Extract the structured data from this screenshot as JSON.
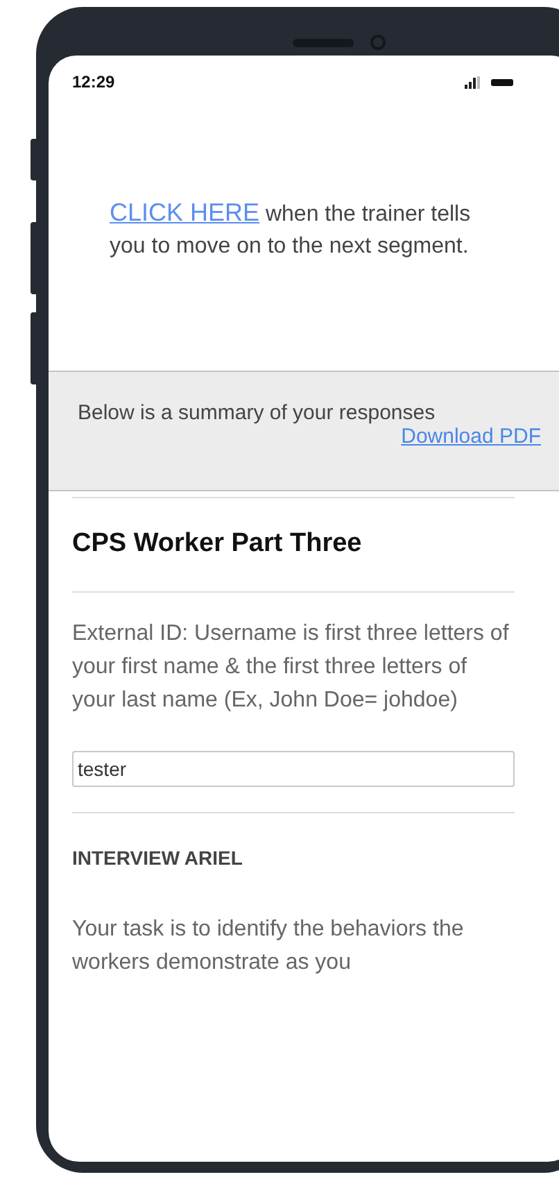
{
  "status_bar": {
    "time": "12:29"
  },
  "prompt": {
    "link": "CLICK HERE",
    "text": "when the trainer tells you to move on to the next segment."
  },
  "summary": {
    "text": "Below is a summary of your responses",
    "download_link": "Download PDF"
  },
  "section": {
    "title": "CPS Worker Part Three",
    "question": "External ID: Username is first three letters of your first name & the first three letters of your last name (Ex, John Doe= johdoe)",
    "answer": "tester"
  },
  "subsection": {
    "heading": "INTERVIEW ARIEL",
    "text": "Your task is to identify the behaviors the workers demonstrate as you"
  }
}
